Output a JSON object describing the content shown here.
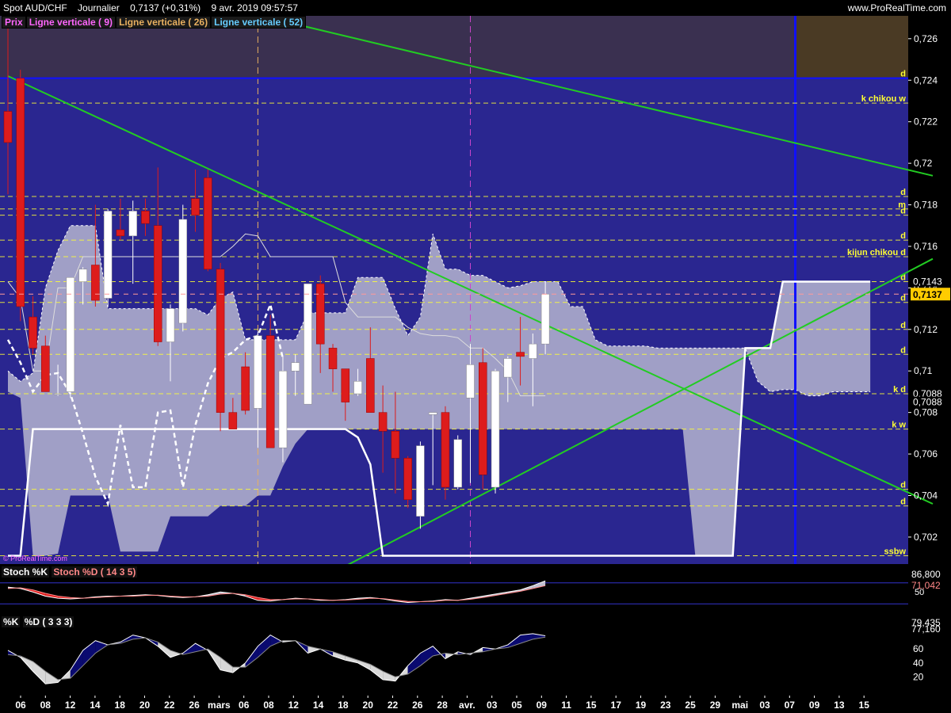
{
  "header": {
    "instrument": "Spot AUD/CHF",
    "period": "Journalier",
    "price": "0,7137 (+0,31%)",
    "datetime": "9 avr. 2019 09:57:57",
    "site": "www.ProRealTime.com"
  },
  "legend": {
    "prix": "Prix",
    "v9": "Ligne verticale ( 9)",
    "v26": "Ligne verticale ( 26)",
    "v52": "Ligne verticale ( 52)"
  },
  "watermark": "© ProRealTime.com",
  "colors": {
    "background": "#2a2690",
    "bull": "#ffffff",
    "bear": "#dd1c1c",
    "trendline": "#22cc22",
    "cloud": "#c8c8d8",
    "kijun": "#ffffff",
    "level": "#ffff33",
    "v9": "#cc44cc",
    "v26": "#e8b060",
    "v52": "#1010ff"
  },
  "chart_data": {
    "type": "candlestick",
    "ylim": [
      0.7007,
      0.7271
    ],
    "yticks": [
      "0,726",
      "0,724",
      "0,722",
      "0,72",
      "0,718",
      "0,716",
      "0,714",
      "0,712",
      "0,71",
      "0,708",
      "0,706",
      "0,704",
      "0,702"
    ],
    "current_price_label": "0,7137",
    "price_labels_right": [
      "0,7143",
      "0,7088",
      "0,7088"
    ],
    "x_labels": [
      "06",
      "08",
      "12",
      "14",
      "18",
      "20",
      "22",
      "26",
      "mars",
      "06",
      "08",
      "12",
      "14",
      "18",
      "20",
      "22",
      "26",
      "28",
      "avr.",
      "03",
      "05",
      "09",
      "11",
      "15",
      "17",
      "19",
      "23",
      "25",
      "29",
      "mai",
      "03",
      "07",
      "09",
      "13",
      "15"
    ],
    "candles": [
      {
        "o": 0.7225,
        "h": 0.7267,
        "l": 0.7185,
        "c": 0.721
      },
      {
        "o": 0.7241,
        "h": 0.7245,
        "l": 0.7124,
        "c": 0.7131
      },
      {
        "o": 0.7126,
        "h": 0.7136,
        "l": 0.7108,
        "c": 0.7111
      },
      {
        "o": 0.7112,
        "h": 0.7117,
        "l": 0.7093,
        "c": 0.709
      },
      {
        "o": 0.7089,
        "h": 0.7103,
        "l": 0.7088,
        "c": 0.7089
      },
      {
        "o": 0.709,
        "h": 0.7144,
        "l": 0.7087,
        "c": 0.7145
      },
      {
        "o": 0.7143,
        "h": 0.715,
        "l": 0.7132,
        "c": 0.7149
      },
      {
        "o": 0.7151,
        "h": 0.718,
        "l": 0.7131,
        "c": 0.7134
      },
      {
        "o": 0.7135,
        "h": 0.7178,
        "l": 0.7131,
        "c": 0.7177
      },
      {
        "o": 0.7168,
        "h": 0.7183,
        "l": 0.7163,
        "c": 0.7165
      },
      {
        "o": 0.7165,
        "h": 0.7182,
        "l": 0.7142,
        "c": 0.7177
      },
      {
        "o": 0.7177,
        "h": 0.7183,
        "l": 0.7165,
        "c": 0.7171
      },
      {
        "o": 0.717,
        "h": 0.7198,
        "l": 0.7112,
        "c": 0.7114
      },
      {
        "o": 0.7114,
        "h": 0.7132,
        "l": 0.7095,
        "c": 0.713
      },
      {
        "o": 0.7123,
        "h": 0.718,
        "l": 0.7119,
        "c": 0.7173
      },
      {
        "o": 0.7183,
        "h": 0.7197,
        "l": 0.7167,
        "c": 0.7175
      },
      {
        "o": 0.7193,
        "h": 0.7197,
        "l": 0.7148,
        "c": 0.7149
      },
      {
        "o": 0.7149,
        "h": 0.7152,
        "l": 0.7071,
        "c": 0.708
      },
      {
        "o": 0.708,
        "h": 0.7087,
        "l": 0.7073,
        "c": 0.7072
      },
      {
        "o": 0.7102,
        "h": 0.7109,
        "l": 0.7079,
        "c": 0.7081
      },
      {
        "o": 0.7082,
        "h": 0.7119,
        "l": 0.7063,
        "c": 0.7117
      },
      {
        "o": 0.7117,
        "h": 0.7127,
        "l": 0.7064,
        "c": 0.7063
      },
      {
        "o": 0.7063,
        "h": 0.7107,
        "l": 0.7056,
        "c": 0.71
      },
      {
        "o": 0.71,
        "h": 0.7108,
        "l": 0.7088,
        "c": 0.7104
      },
      {
        "o": 0.7084,
        "h": 0.714,
        "l": 0.7084,
        "c": 0.7142
      },
      {
        "o": 0.7142,
        "h": 0.7146,
        "l": 0.7099,
        "c": 0.7113
      },
      {
        "o": 0.7111,
        "h": 0.7113,
        "l": 0.709,
        "c": 0.7101
      },
      {
        "o": 0.7101,
        "h": 0.7101,
        "l": 0.7076,
        "c": 0.7085
      },
      {
        "o": 0.7089,
        "h": 0.7101,
        "l": 0.7088,
        "c": 0.7095
      },
      {
        "o": 0.7106,
        "h": 0.7121,
        "l": 0.7086,
        "c": 0.708
      },
      {
        "o": 0.708,
        "h": 0.7093,
        "l": 0.7051,
        "c": 0.7071
      },
      {
        "o": 0.7071,
        "h": 0.709,
        "l": 0.7041,
        "c": 0.7058
      },
      {
        "o": 0.7058,
        "h": 0.7059,
        "l": 0.7034,
        "c": 0.7038
      },
      {
        "o": 0.703,
        "h": 0.7066,
        "l": 0.7024,
        "c": 0.7064
      },
      {
        "o": 0.7079,
        "h": 0.708,
        "l": 0.7045,
        "c": 0.708
      },
      {
        "o": 0.708,
        "h": 0.7083,
        "l": 0.7038,
        "c": 0.7044
      },
      {
        "o": 0.7044,
        "h": 0.7069,
        "l": 0.7043,
        "c": 0.7067
      },
      {
        "o": 0.7087,
        "h": 0.7113,
        "l": 0.7046,
        "c": 0.7103
      },
      {
        "o": 0.7104,
        "h": 0.7111,
        "l": 0.7043,
        "c": 0.705
      },
      {
        "o": 0.7044,
        "h": 0.7101,
        "l": 0.7041,
        "c": 0.71
      },
      {
        "o": 0.7097,
        "h": 0.7107,
        "l": 0.7085,
        "c": 0.7106
      },
      {
        "o": 0.7109,
        "h": 0.7126,
        "l": 0.7093,
        "c": 0.7107
      },
      {
        "o": 0.7106,
        "h": 0.7118,
        "l": 0.7083,
        "c": 0.7113
      },
      {
        "o": 0.7113,
        "h": 0.7143,
        "l": 0.7108,
        "c": 0.7137
      }
    ],
    "kijun": [
      0.7011,
      0.7011,
      0.7072,
      0.7072,
      0.7072,
      0.7072,
      0.7072,
      0.7072,
      0.7072,
      0.7072,
      0.7072,
      0.7072,
      0.7072,
      0.7072,
      0.7072,
      0.7072,
      0.7072,
      0.7072,
      0.7072,
      0.7072,
      0.7072,
      0.7072,
      0.7072,
      0.7072,
      0.7072,
      0.7072,
      0.7072,
      0.7072,
      0.7068,
      0.7055,
      0.7011,
      0.7011,
      0.7011,
      0.7011,
      0.7011,
      0.7011,
      0.7011,
      0.7011,
      0.7011,
      0.7011,
      0.7011,
      0.7011,
      0.7011,
      0.7011,
      0.7011,
      0.7011,
      0.7011,
      0.7011,
      0.7011,
      0.7011,
      0.7011,
      0.7011,
      0.7011,
      0.7011,
      0.7011,
      0.7011,
      0.7011,
      0.7011,
      0.7011,
      0.7111,
      0.7111,
      0.7111,
      0.7143,
      0.7143,
      0.7143,
      0.7143,
      0.7143,
      0.7143,
      0.7143,
      0.7143
    ],
    "tenkan": [
      0.7143,
      0.7135,
      0.71,
      0.71,
      0.714,
      0.714,
      0.7155,
      0.7155,
      0.7155,
      0.7155,
      0.7155,
      0.7155,
      0.7155,
      0.7155,
      0.7155,
      0.7155,
      0.7155,
      0.7155,
      0.716,
      0.7166,
      0.7165,
      0.7155,
      0.7155,
      0.7155,
      0.7155,
      0.7155,
      0.7155,
      0.7133,
      0.7126,
      0.7126,
      0.7126,
      0.7126,
      0.7121,
      0.7118,
      0.7117,
      0.7117,
      0.7116,
      0.7111,
      0.7111,
      0.7106,
      0.71,
      0.7088,
      0.7088,
      0.7088
    ],
    "chikou": [
      0.7115,
      0.7104,
      0.709,
      0.7098,
      0.7099,
      0.7089,
      0.707,
      0.7049,
      0.7036,
      0.7074,
      0.7044,
      0.7044,
      0.708,
      0.7081,
      0.7044,
      0.7074,
      0.7094,
      0.7106,
      0.7109,
      0.7115,
      0.7117,
      0.7132,
      0.7106
    ],
    "cloud_upper": [
      0.71,
      0.7095,
      0.7099,
      0.714,
      0.7158,
      0.717,
      0.717,
      0.717,
      0.713,
      0.713,
      0.713,
      0.713,
      0.713,
      0.713,
      0.713,
      0.713,
      0.7127,
      0.7135,
      0.7138,
      0.7115,
      0.7115,
      0.7115,
      0.7115,
      0.7115,
      0.7128,
      0.7128,
      0.7128,
      0.7128,
      0.7145,
      0.7145,
      0.7145,
      0.713,
      0.7117,
      0.7126,
      0.7166,
      0.7149,
      0.7149,
      0.7146,
      0.7146,
      0.7143,
      0.714,
      0.7141,
      0.7143,
      0.7143,
      0.7143,
      0.7131,
      0.7131,
      0.7115,
      0.7112,
      0.7112,
      0.7112,
      0.7112,
      0.7111,
      0.7111,
      0.7111,
      0.7111,
      0.7111,
      0.7111,
      0.7111,
      0.7111,
      0.7095,
      0.709,
      0.7091,
      0.7091,
      0.7088,
      0.7088,
      0.709,
      0.709,
      0.709,
      0.709
    ],
    "cloud_lower": [
      0.709,
      0.7087,
      0.7011,
      0.7011,
      0.7012,
      0.704,
      0.704,
      0.704,
      0.704,
      0.7013,
      0.7013,
      0.7013,
      0.7013,
      0.703,
      0.703,
      0.703,
      0.703,
      0.7035,
      0.7035,
      0.7035,
      0.704,
      0.704,
      0.7054,
      0.7065,
      0.7072,
      0.7072,
      0.7072,
      0.7072,
      0.7072,
      0.7072,
      0.7072,
      0.7072,
      0.7072,
      0.7072,
      0.7072,
      0.7072,
      0.7072,
      0.7072,
      0.7072,
      0.7072,
      0.7072,
      0.7072,
      0.7072,
      0.7072,
      0.7072,
      0.7072,
      0.7072,
      0.7072,
      0.7072,
      0.7072,
      0.7072,
      0.7072,
      0.7072,
      0.7072,
      0.7072,
      0.7011,
      0.7011,
      0.7011,
      0.7011,
      0.7111,
      0.7111,
      0.7111,
      0.7143,
      0.7143,
      0.7143,
      0.7143,
      0.7143,
      0.7143,
      0.7143,
      0.7143
    ],
    "trendlines": [
      {
        "from": [
          0,
          0.7242
        ],
        "to": [
          74,
          0.7036
        ]
      },
      {
        "from": [
          27,
          0.7006
        ],
        "to": [
          74,
          0.7154
        ]
      },
      {
        "from": [
          23,
          0.7267
        ],
        "to": [
          74,
          0.7194
        ]
      }
    ],
    "horizontal_levels": [
      {
        "price": 0.7241,
        "label": "d"
      },
      {
        "price": 0.7229,
        "label": "k chikou w"
      },
      {
        "price": 0.7184,
        "label": "d"
      },
      {
        "price": 0.7178,
        "label": "m"
      },
      {
        "price": 0.7175,
        "label": "d"
      },
      {
        "price": 0.7163,
        "label": "d"
      },
      {
        "price": 0.7155,
        "label": "kijun chikou d"
      },
      {
        "price": 0.7143,
        "label": "d"
      },
      {
        "price": 0.7133,
        "label": "d"
      },
      {
        "price": 0.712,
        "label": "d"
      },
      {
        "price": 0.7108,
        "label": "d"
      },
      {
        "price": 0.7089,
        "label": "k d"
      },
      {
        "price": 0.7072,
        "label": "k w"
      },
      {
        "price": 0.7043,
        "label": "d"
      },
      {
        "price": 0.7035,
        "label": "d"
      },
      {
        "price": 0.7011,
        "label": "ssbw"
      }
    ],
    "vertical_lines": [
      {
        "index": 20,
        "name": "Ligne verticale ( 26)"
      },
      {
        "index": 37,
        "name": "Ligne verticale ( 9)"
      },
      {
        "index": 63,
        "name": "Ligne verticale ( 52)"
      }
    ]
  },
  "stoch": {
    "title": "Stoch %K",
    "title2": "Stoch %D ( 14 3 5)",
    "value1": "86,800",
    "value2": "71,042",
    "level_label": "50",
    "k": [
      68,
      64,
      54,
      42,
      36,
      34,
      36,
      40,
      42,
      42,
      44,
      46,
      44,
      40,
      38,
      40,
      46,
      54,
      50,
      42,
      30,
      28,
      32,
      36,
      34,
      30,
      30,
      32,
      36,
      38,
      34,
      28,
      24,
      26,
      28,
      32,
      30,
      36,
      42,
      48,
      54,
      60,
      72,
      86
    ],
    "d": [
      64,
      66,
      60,
      50,
      42,
      38,
      36,
      38,
      40,
      42,
      42,
      44,
      45,
      42,
      40,
      40,
      42,
      48,
      50,
      46,
      38,
      32,
      32,
      34,
      34,
      32,
      30,
      31,
      33,
      36,
      35,
      31,
      27,
      26,
      27,
      30,
      30,
      33,
      38,
      44,
      50,
      56,
      64,
      72
    ]
  },
  "kd": {
    "title": "%K",
    "title2": "%D ( 3 3 3)",
    "value1": "79,435",
    "value2": "77,160",
    "yticks": [
      "60",
      "40",
      "20"
    ],
    "k": [
      58,
      48,
      28,
      10,
      12,
      30,
      58,
      72,
      66,
      70,
      80,
      76,
      64,
      48,
      54,
      68,
      58,
      30,
      26,
      40,
      64,
      80,
      70,
      72,
      54,
      60,
      50,
      44,
      40,
      30,
      16,
      14,
      36,
      54,
      64,
      46,
      56,
      52,
      62,
      60,
      66,
      80,
      82,
      79
    ],
    "d": [
      52,
      50,
      42,
      28,
      16,
      18,
      36,
      54,
      66,
      68,
      74,
      76,
      70,
      58,
      52,
      56,
      60,
      48,
      34,
      34,
      48,
      64,
      72,
      72,
      64,
      60,
      56,
      50,
      44,
      38,
      28,
      20,
      24,
      36,
      50,
      54,
      52,
      54,
      56,
      60,
      62,
      68,
      74,
      77
    ]
  }
}
